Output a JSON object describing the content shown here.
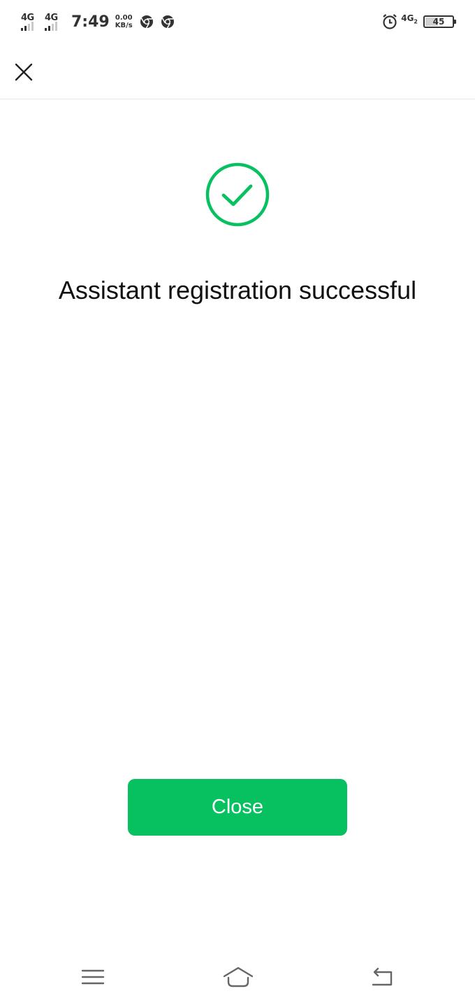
{
  "status_bar": {
    "sim1_network": "4G",
    "sim2_network": "4G",
    "time": "7:49",
    "speed_value": "0.00",
    "speed_unit": "KB/s",
    "right_network": "4G",
    "right_network_sub": "2",
    "battery_level": "45",
    "battery_fraction": 0.45,
    "icons": [
      "signal-icon",
      "signal-icon",
      "chrome-icon",
      "chrome-icon",
      "alarm-icon",
      "battery-icon"
    ]
  },
  "header": {
    "close_icon": "close-icon"
  },
  "content": {
    "success_icon": "check-circle-icon",
    "message": "Assistant registration successful",
    "close_button_label": "Close"
  },
  "nav_bar": {
    "icons": [
      "menu-icon",
      "home-icon",
      "back-icon"
    ]
  },
  "colors": {
    "accent": "#07c160",
    "text": "#111111",
    "divider": "#e6e6e6"
  }
}
